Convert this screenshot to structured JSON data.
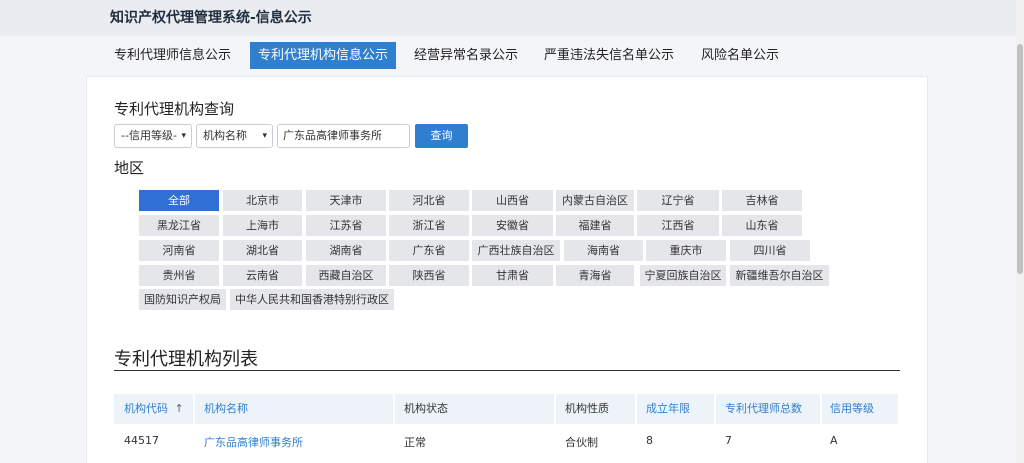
{
  "header": {
    "title": "知识产权代理管理系统-信息公示"
  },
  "tabs": [
    {
      "label": "专利代理师信息公示",
      "active": false
    },
    {
      "label": "专利代理机构信息公示",
      "active": true
    },
    {
      "label": "经营异常名录公示",
      "active": false
    },
    {
      "label": "严重违法失信名单公示",
      "active": false
    },
    {
      "label": "风险名单公示",
      "active": false
    }
  ],
  "query": {
    "title": "专利代理机构查询",
    "credit_select": "--信用等级-",
    "field_select": "机构名称",
    "keyword": "广东品高律师事务所",
    "search_label": "查询"
  },
  "region": {
    "title": "地区",
    "items": [
      "全部",
      "北京市",
      "天津市",
      "河北省",
      "山西省",
      "内蒙古自治区",
      "辽宁省",
      "吉林省",
      "黑龙江省",
      "上海市",
      "江苏省",
      "浙江省",
      "安徽省",
      "福建省",
      "江西省",
      "山东省",
      "河南省",
      "湖北省",
      "湖南省",
      "广东省",
      "广西壮族自治区",
      "海南省",
      "重庆市",
      "四川省",
      "贵州省",
      "云南省",
      "西藏自治区",
      "陕西省",
      "甘肃省",
      "青海省",
      "宁夏回族自治区",
      "新疆维吾尔自治区",
      "国防知识产权局",
      "中华人民共和国香港特别行政区"
    ],
    "active": "全部"
  },
  "list": {
    "title": "专利代理机构列表",
    "columns": [
      "机构代码",
      "机构名称",
      "机构状态",
      "机构性质",
      "成立年限",
      "专利代理师总数",
      "信用等级"
    ],
    "sort_icon": "↑",
    "rows": [
      [
        "44517",
        "广东品高律师事务所",
        "正常",
        "合伙制",
        "8",
        "7",
        "A"
      ]
    ]
  },
  "colors": {
    "accent": "#2f7fd1",
    "region_active": "#2f6fd6"
  }
}
